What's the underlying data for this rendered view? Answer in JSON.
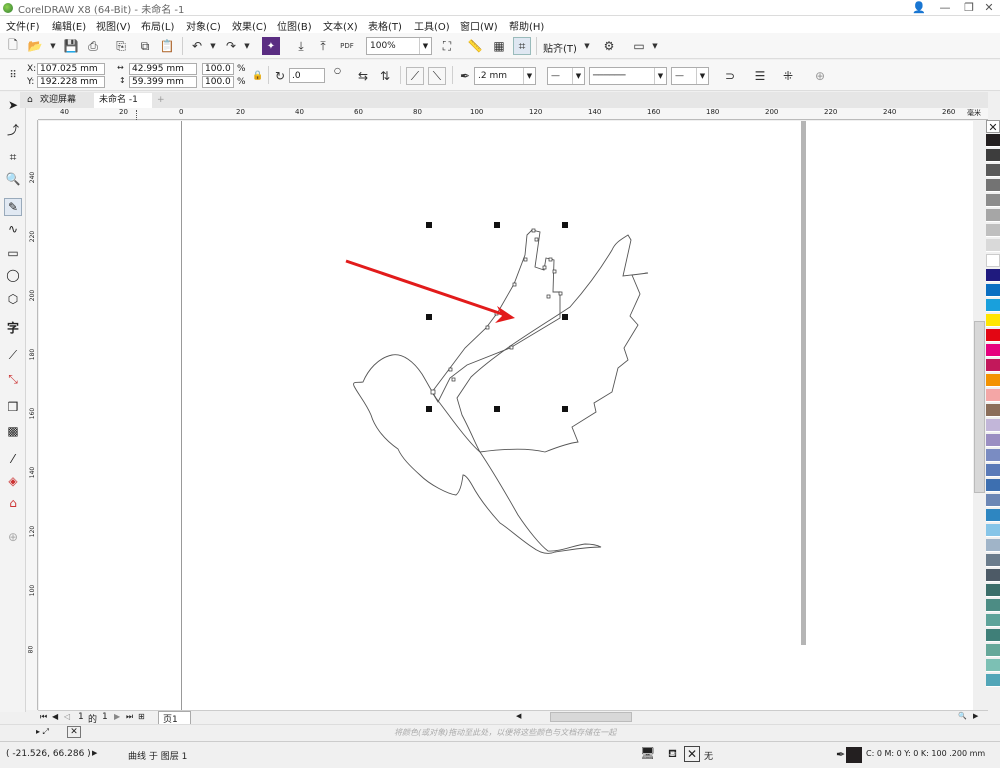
{
  "title": "CorelDRAW X8 (64-Bit) - 未命名 -1",
  "menu": [
    "文件(F)",
    "编辑(E)",
    "视图(V)",
    "布局(L)",
    "对象(C)",
    "效果(C)",
    "位图(B)",
    "文本(X)",
    "表格(T)",
    "工具(O)",
    "窗口(W)",
    "帮助(H)"
  ],
  "toolbar1": {
    "zoom": "100%",
    "snap_label": "贴齐(T)",
    "pdf_label": "PDF"
  },
  "properties": {
    "x": "107.025 mm",
    "y": "192.228 mm",
    "width": "42.995 mm",
    "height": "59.399 mm",
    "scale_x": "100.0",
    "scale_y": "100.0",
    "percent": "%",
    "rotation": ".0",
    "outline_width": ".2 mm"
  },
  "tabs": {
    "welcome": "欢迎屏幕",
    "document": "未命名 -1"
  },
  "ruler": {
    "h_labels": [
      "40",
      "20",
      "0",
      "20",
      "40",
      "60",
      "80",
      "100",
      "120",
      "140",
      "160",
      "180",
      "200",
      "220",
      "240",
      "260"
    ],
    "h_unit": "毫米",
    "v_labels": [
      "240",
      "220",
      "200",
      "180",
      "160",
      "140",
      "120",
      "100",
      "80"
    ]
  },
  "page_nav": {
    "current": "1",
    "of": "的",
    "total": "1",
    "page_tab": "页1"
  },
  "colorbar_hint": "将颜色(或对象)拖动至此处，以便将这些颜色与文档存储在一起",
  "status": {
    "cursor": "( -21.526, 66.286 )",
    "selection": "曲线 于 图层 1",
    "fill_none": "无",
    "outline_info": "C: 0 M: 0 Y: 0 K: 100  .200 mm"
  },
  "palette_colors": [
    "#231f20",
    "#3d3d3d",
    "#595959",
    "#737373",
    "#8c8c8c",
    "#a6a6a6",
    "#bfbfbf",
    "#d9d9d9",
    "#ffffff",
    "#1f1a7e",
    "#0a6fc2",
    "#19a0dc",
    "#ffe500",
    "#e30613",
    "#e6007e",
    "#c2185b",
    "#f39200",
    "#f4a6a6",
    "#8b6e5a",
    "#c2b6d9",
    "#9a8ec2",
    "#7a8cc2",
    "#5a7ab8",
    "#3d6fb0",
    "#6c87b5",
    "#2e86c1",
    "#86c5e8",
    "#a0b4c8",
    "#6b7c8c",
    "#4d5a66",
    "#3b6e6a",
    "#4c8c84",
    "#5ea39a",
    "#3f7f78",
    "#66a89a",
    "#7cc0b4",
    "#52a6b8"
  ],
  "icons": {
    "toolbox": [
      "pick-tool-icon",
      "shape-tool-icon",
      "crop-tool-icon",
      "zoom-tool-icon",
      "freehand-tool-icon",
      "artistic-media-icon",
      "rectangle-tool-icon",
      "ellipse-tool-icon",
      "polygon-tool-icon",
      "text-tool-icon",
      "parallel-dimension-icon",
      "connector-icon",
      "drop-shadow-icon",
      "transparency-icon",
      "eyedropper-icon",
      "interactive-fill-icon",
      "smart-fill-icon",
      "add-tool-icon"
    ]
  }
}
